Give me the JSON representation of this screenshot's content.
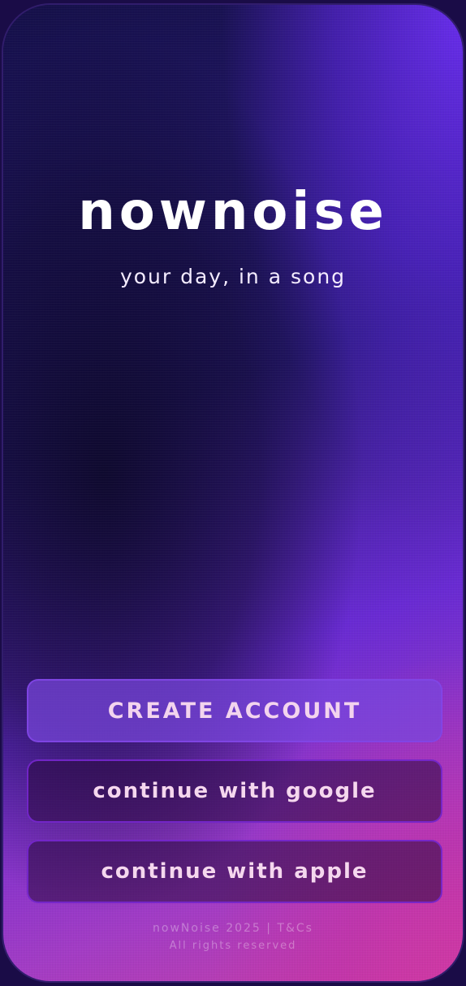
{
  "app": {
    "logo": "nownoise",
    "tagline": "your day, in a song"
  },
  "actions": {
    "create_account": "CREATE ACCOUNT",
    "continue_google": "continue with google",
    "continue_apple": "continue with apple"
  },
  "footer": {
    "copyright": "nowNoise 2025 | T&Cs",
    "rights": "All rights reserved"
  },
  "colors": {
    "background_dark": "#15104a",
    "accent_purple": "#6a2ef0",
    "accent_pink": "#d63aa6",
    "button_text": "#f5d7ee"
  }
}
